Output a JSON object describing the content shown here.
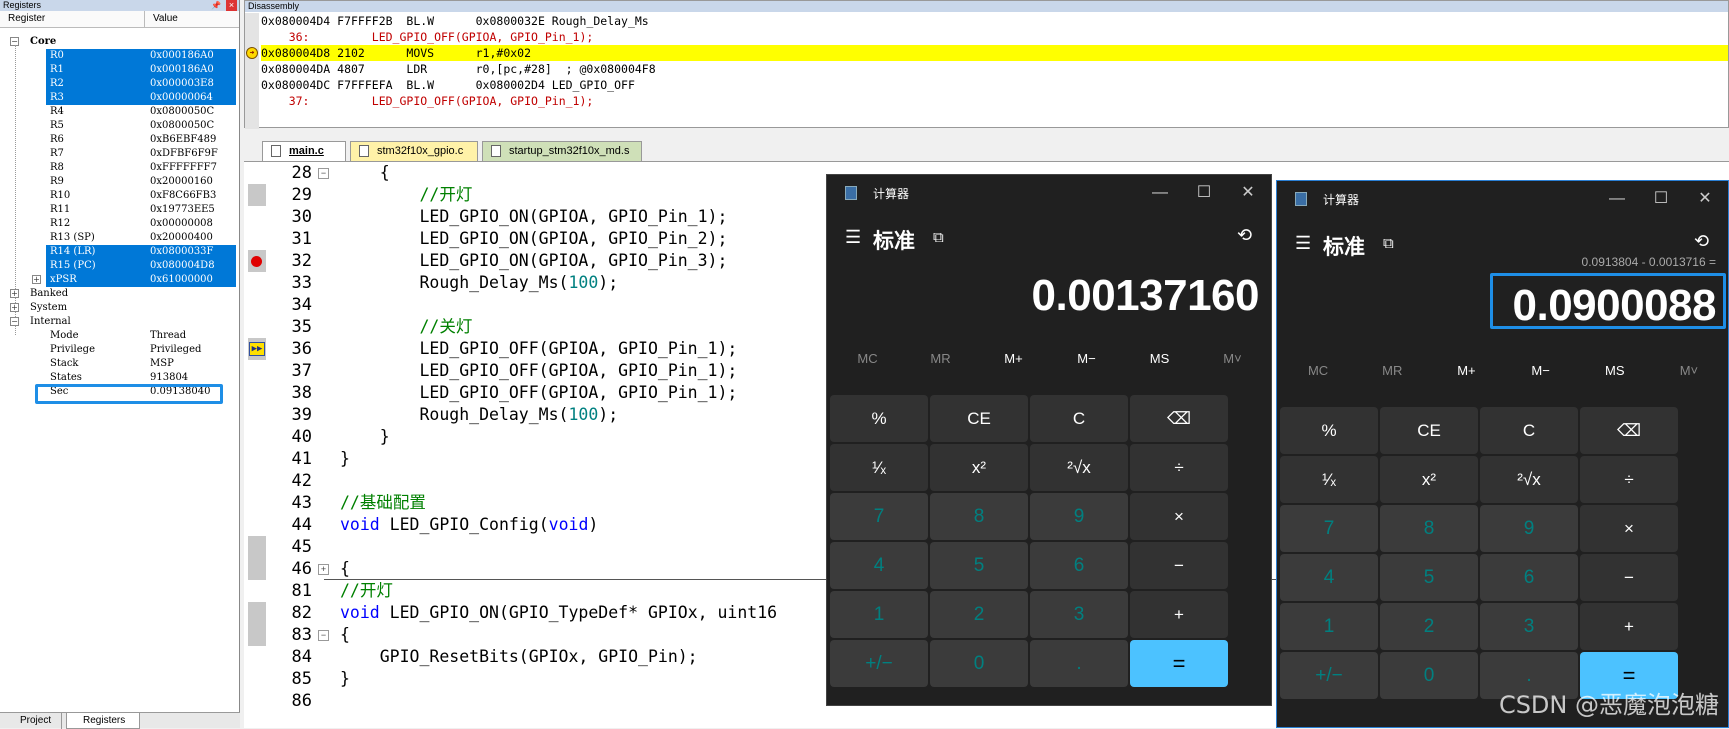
{
  "registers": {
    "title": "Registers",
    "col_register": "Register",
    "col_value": "Value",
    "core_label": "Core",
    "core": [
      {
        "name": "R0",
        "value": "0x000186A0",
        "selected": true
      },
      {
        "name": "R1",
        "value": "0x000186A0",
        "selected": true
      },
      {
        "name": "R2",
        "value": "0x000003E8",
        "selected": true
      },
      {
        "name": "R3",
        "value": "0x00000064",
        "selected": true
      },
      {
        "name": "R4",
        "value": "0x0800050C",
        "selected": false
      },
      {
        "name": "R5",
        "value": "0x0800050C",
        "selected": false
      },
      {
        "name": "R6",
        "value": "0xB6EBF489",
        "selected": false
      },
      {
        "name": "R7",
        "value": "0xDFBF6F9F",
        "selected": false
      },
      {
        "name": "R8",
        "value": "0xFFFFFFF7",
        "selected": false
      },
      {
        "name": "R9",
        "value": "0x20000160",
        "selected": false
      },
      {
        "name": "R10",
        "value": "0xF8C66FB3",
        "selected": false
      },
      {
        "name": "R11",
        "value": "0x19773EE5",
        "selected": false
      },
      {
        "name": "R12",
        "value": "0x00000008",
        "selected": false
      },
      {
        "name": "R13 (SP)",
        "value": "0x20000400",
        "selected": false
      },
      {
        "name": "R14 (LR)",
        "value": "0x0800033F",
        "selected": true
      },
      {
        "name": "R15 (PC)",
        "value": "0x080004D8",
        "selected": true
      },
      {
        "name": "xPSR",
        "value": "0x61000000",
        "selected": true
      }
    ],
    "groups": [
      "Banked",
      "System",
      "Internal"
    ],
    "internal": [
      {
        "name": "Mode",
        "value": "Thread"
      },
      {
        "name": "Privilege",
        "value": "Privileged"
      },
      {
        "name": "Stack",
        "value": "MSP"
      },
      {
        "name": "States",
        "value": "913804"
      },
      {
        "name": "Sec",
        "value": "0.09138040"
      }
    ],
    "tab_project": "Project",
    "tab_registers": "Registers"
  },
  "disassembly": {
    "title": "Disassembly",
    "lines": [
      {
        "text": "0x080004D4 F7FFFF2B  BL.W      0x0800032E Rough_Delay_Ms",
        "style": "normal"
      },
      {
        "text": "    36:         LED_GPIO_OFF(GPIOA, GPIO_Pin_1);",
        "style": "red"
      },
      {
        "text": "0x080004D8 2102      MOVS      r1,#0x02",
        "style": "current"
      },
      {
        "text": "0x080004DA 4807      LDR       r0,[pc,#28]  ; @0x080004F8",
        "style": "normal"
      },
      {
        "text": "0x080004DC F7FFFEFA  BL.W      0x080002D4 LED_GPIO_OFF",
        "style": "normal"
      },
      {
        "text": "    37:         LED_GPIO_OFF(GPIOA, GPIO_Pin_1);",
        "style": "red"
      }
    ]
  },
  "editor": {
    "tabs": [
      {
        "label": "main.c",
        "active": true,
        "color": "#ffffff"
      },
      {
        "label": "stm32f10x_gpio.c",
        "active": false,
        "color": "#fff2a8"
      },
      {
        "label": "startup_stm32f10x_md.s",
        "active": false,
        "color": "#cfe0b8"
      }
    ],
    "lines": [
      {
        "n": "28",
        "code": "    {"
      },
      {
        "n": "29",
        "code": "        //开灯",
        "type": "comment"
      },
      {
        "n": "30",
        "code": "        LED_GPIO_ON(GPIOA, GPIO_Pin_1);"
      },
      {
        "n": "31",
        "code": "        LED_GPIO_ON(GPIOA, GPIO_Pin_2);"
      },
      {
        "n": "32",
        "code": "        LED_GPIO_ON(GPIOA, GPIO_Pin_3);"
      },
      {
        "n": "33",
        "code": "        Rough_Delay_Ms(100);",
        "type": "delay"
      },
      {
        "n": "34",
        "code": ""
      },
      {
        "n": "35",
        "code": "        //关灯",
        "type": "comment"
      },
      {
        "n": "36",
        "code": "        LED_GPIO_OFF(GPIOA, GPIO_Pin_1);"
      },
      {
        "n": "37",
        "code": "        LED_GPIO_OFF(GPIOA, GPIO_Pin_1);"
      },
      {
        "n": "38",
        "code": "        LED_GPIO_OFF(GPIOA, GPIO_Pin_1);"
      },
      {
        "n": "39",
        "code": "        Rough_Delay_Ms(100);",
        "type": "delay"
      },
      {
        "n": "40",
        "code": "    }"
      },
      {
        "n": "41",
        "code": "}"
      },
      {
        "n": "42",
        "code": ""
      },
      {
        "n": "43",
        "code": "//基础配置",
        "type": "comment"
      },
      {
        "n": "44",
        "code": "void LED_GPIO_Config(void)",
        "type": "void"
      },
      {
        "n": "45",
        "code": ""
      },
      {
        "n": "46",
        "code": "{"
      },
      {
        "n": "81",
        "code": "//开灯",
        "type": "comment"
      },
      {
        "n": "82",
        "code": "void LED_GPIO_ON(GPIO_TypeDef* GPIOx, uint16",
        "type": "voidfn"
      },
      {
        "n": "83",
        "code": "{"
      },
      {
        "n": "84",
        "code": "    GPIO_ResetBits(GPIOx, GPIO_Pin);"
      },
      {
        "n": "85",
        "code": "}"
      },
      {
        "n": "86",
        "code": ""
      }
    ]
  },
  "calc1": {
    "title": "计算器",
    "mode": "标准",
    "expression": "",
    "display": "0.00137160",
    "memory": [
      "MC",
      "MR",
      "M+",
      "M−",
      "MS",
      "M˅"
    ],
    "keys": [
      "%",
      "CE",
      "C",
      "⌫",
      "¹⁄ₓ",
      "x²",
      "²√x",
      "÷",
      "7",
      "8",
      "9",
      "×",
      "4",
      "5",
      "6",
      "−",
      "1",
      "2",
      "3",
      "+",
      "+/−",
      "0",
      ".",
      "="
    ]
  },
  "calc2": {
    "title": "计算器",
    "mode": "标准",
    "expression": "0.0913804 - 0.0013716 =",
    "display": "0.0900088",
    "memory": [
      "MC",
      "MR",
      "M+",
      "M−",
      "MS",
      "M˅"
    ],
    "keys": [
      "%",
      "CE",
      "C",
      "⌫",
      "¹⁄ₓ",
      "x²",
      "²√x",
      "÷",
      "7",
      "8",
      "9",
      "×",
      "4",
      "5",
      "6",
      "−",
      "1",
      "2",
      "3",
      "+",
      "+/−",
      "0",
      ".",
      "="
    ]
  },
  "watermark": "CSDN @恶魔泡泡糖"
}
